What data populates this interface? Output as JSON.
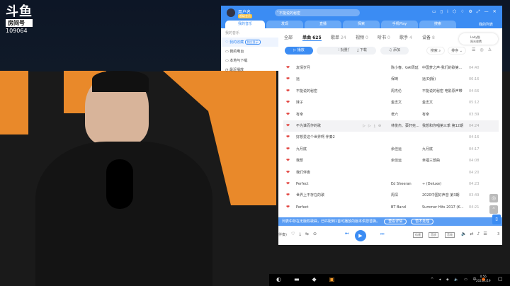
{
  "overlay": {
    "brand": "斗鱼",
    "room_label": "房间号",
    "room_id": "109064"
  },
  "app": {
    "user": "用户名",
    "vip": "超级会员",
    "search_placeholder": "不能说的秘密",
    "tabs": [
      "我的音乐",
      "发现",
      "直播",
      "探索",
      "手机Play",
      "搜索"
    ],
    "playlist_btn": "我的列表",
    "sidebar": {
      "title": "我的音乐",
      "items": [
        "我的收藏",
        "我的电台",
        "本地与下载",
        "最近播放"
      ],
      "badge": "独立显示"
    },
    "content_tabs": [
      {
        "label": "全部",
        "count": ""
      },
      {
        "label": "单曲",
        "count": "625"
      },
      {
        "label": "歌单",
        "count": "24"
      },
      {
        "label": "视频",
        "count": "0"
      },
      {
        "label": "听书",
        "count": "0"
      },
      {
        "label": "歌手",
        "count": "4"
      },
      {
        "label": "设备",
        "count": "8"
      }
    ],
    "buttons": {
      "play": "播放",
      "batch": "批量操作",
      "download": "下载",
      "add": "添加",
      "search": "搜索",
      "sort": "排序"
    },
    "friend": {
      "name": "Lady猫",
      "sub": "阳光收费"
    },
    "songs": [
      {
        "title": "友情岁月",
        "artist": "陈小春、GAI周延",
        "album": "中国梦之声·我们的歌第二季...",
        "duration": "04:40"
      },
      {
        "title": "远",
        "artist": "保琦",
        "album": "远(DJ版)",
        "duration": "06:16"
      },
      {
        "title": "不能说的秘密",
        "artist": "周杰伦",
        "album": "不能说的秘密 电影原声带",
        "duration": "04:56"
      },
      {
        "title": "妹子",
        "artist": "金志文",
        "album": "金志文",
        "duration": "05:12"
      },
      {
        "title": "有幸",
        "artist": "老六",
        "album": "有幸",
        "duration": "03:39"
      },
      {
        "title": "不为谁而作的歌",
        "artist": "林俊杰、蔡轩宪...",
        "album": "我想和你唱第三季 第12期",
        "duration": "04:24"
      },
      {
        "title": "好想爱这个世界啊 伴奏2",
        "artist": "",
        "album": "",
        "duration": "04:16"
      },
      {
        "title": "九月底",
        "artist": "余佳运",
        "album": "九月底",
        "duration": "04:17"
      },
      {
        "title": "我想",
        "artist": "余佳运",
        "album": "幸福三部曲",
        "duration": "04:08"
      },
      {
        "title": "我们伴奏",
        "artist": "",
        "album": "",
        "duration": "04:20"
      },
      {
        "title": "Perfect",
        "artist": "Ed Sheeran",
        "album": "÷ (Deluxe)",
        "duration": "04:23"
      },
      {
        "title": "世界上不存在的歌",
        "artist": "周深",
        "album": "2020中国好声音 第3期",
        "duration": "03:49"
      },
      {
        "title": "Perfect",
        "artist": "BT Band",
        "album": "Summer Hits 2017 (Karao...",
        "duration": "04:21"
      }
    ],
    "notice": {
      "text": "列表中存在无版权歌曲，已匹配到1首可播放的版本供您替换。",
      "view": "查看详情",
      "ignore": "暂不处理"
    },
    "player": {
      "now": "伴奏)",
      "speed": "倍速",
      "quality": "音质",
      "effect": "音效",
      "count": "3"
    }
  },
  "taskbar": {
    "time": "0:56",
    "date": "2021/1/19",
    "ime": "中"
  }
}
